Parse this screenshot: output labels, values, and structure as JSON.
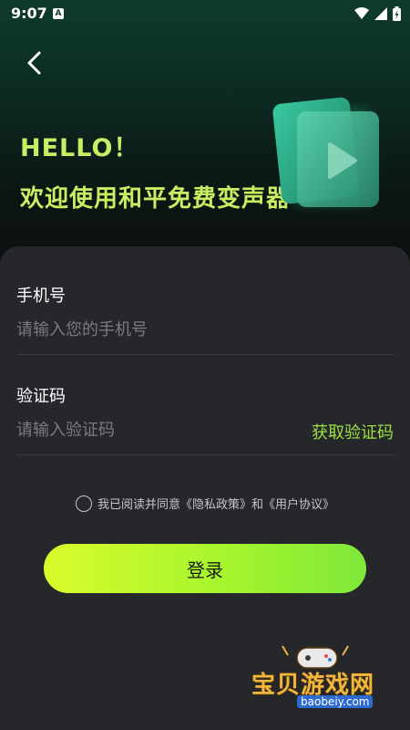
{
  "status_bar": {
    "time": "9:07",
    "icons": [
      "a-notification-icon",
      "wifi-icon",
      "signal-icon",
      "battery-icon"
    ]
  },
  "header": {
    "hello": "HELLO！",
    "welcome": "欢迎使用和平免费变声器"
  },
  "form": {
    "phone_label": "手机号",
    "phone_placeholder": "请输入您的手机号",
    "phone_value": "",
    "code_label": "验证码",
    "code_placeholder": "请输入验证码",
    "code_value": "",
    "get_code": "获取验证码"
  },
  "agreement": {
    "checked": false,
    "text": "我已阅读并同意《隐私政策》和《用户协议》"
  },
  "login_button": "登录",
  "watermark": {
    "name": "宝贝游戏网",
    "domain": "baobeiy.com"
  },
  "colors": {
    "accent_green": "#9be044",
    "title_green": "#c9ee63",
    "card_bg": "#26272b"
  }
}
